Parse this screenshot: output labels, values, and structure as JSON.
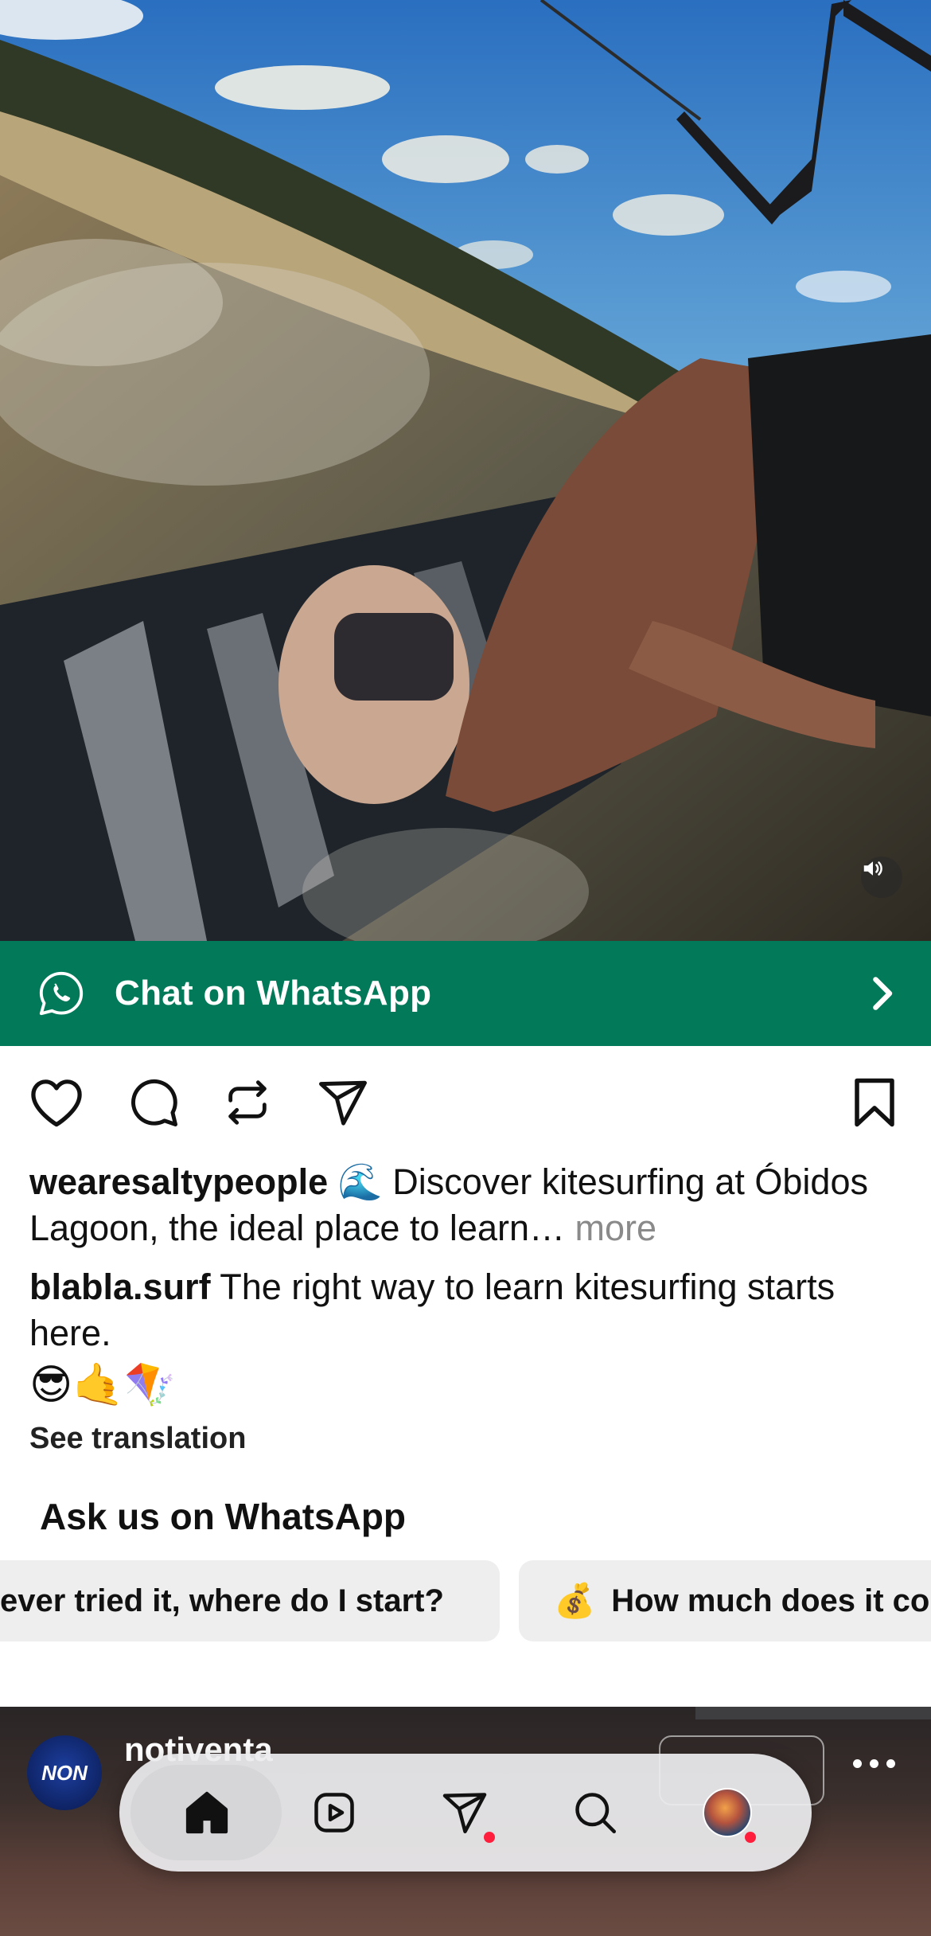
{
  "video": {
    "mute_icon": "speaker-muted-icon"
  },
  "cta": {
    "label": "Chat on WhatsApp",
    "icon": "whatsapp-icon",
    "arrow_icon": "chevron-right-icon",
    "background": "#027a5a"
  },
  "actions": {
    "like_icon": "heart-icon",
    "comment_icon": "comment-icon",
    "repost_icon": "repost-icon",
    "share_icon": "send-icon",
    "save_icon": "bookmark-icon"
  },
  "caption": {
    "username": "wearesaltypeople",
    "emoji": "🌊",
    "text": " Discover kitesurfing at Óbidos Lagoon, the ideal place to learn…",
    "more": " more"
  },
  "caption2": {
    "username": "blabla.surf",
    "text": " The right way to learn kitesurfing starts here."
  },
  "emojis": "😎🤙🪁",
  "see_translation": "See translation",
  "ask": {
    "title": "Ask us on WhatsApp",
    "chips": [
      {
        "label": "ever tried it, where do I start?"
      },
      {
        "emoji": "💰",
        "label": "How much does it co"
      }
    ]
  },
  "next_post": {
    "username": "notiventa",
    "avatar_text": "NON"
  },
  "nav": {
    "items": [
      {
        "name": "home",
        "icon": "home-icon",
        "active": true
      },
      {
        "name": "reels",
        "icon": "reels-icon"
      },
      {
        "name": "messages",
        "icon": "send-icon",
        "badge": true
      },
      {
        "name": "search",
        "icon": "search-icon"
      },
      {
        "name": "profile",
        "icon": "profile-avatar",
        "badge": true
      }
    ],
    "accent": "#ff1f3d"
  }
}
